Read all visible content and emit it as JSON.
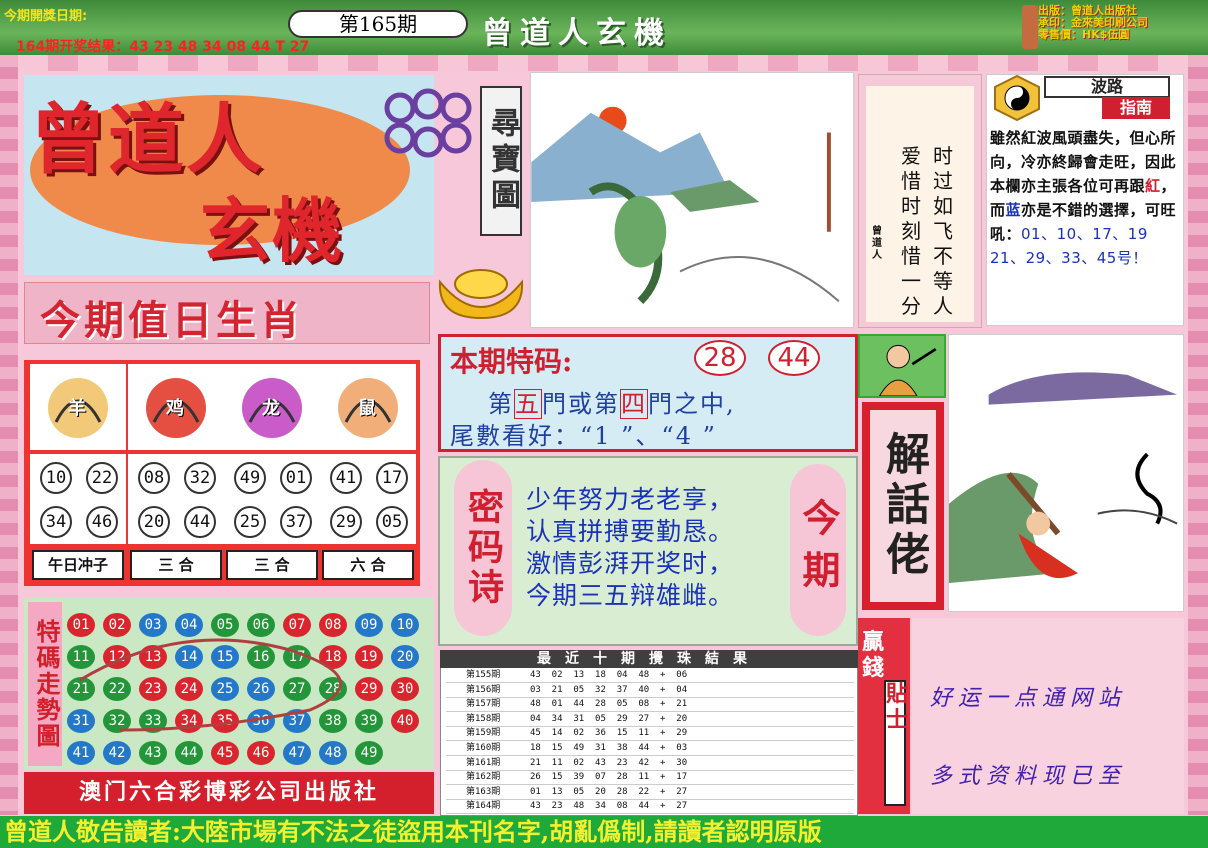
{
  "header": {
    "next_draw_label": "今期開獎日期:",
    "last_result": "164期开奖结果：43 23 48 34 08 44 T 27",
    "issue": "第165期",
    "title": "曾道人玄機",
    "publisher_lines": [
      "出版：曾道人出版社",
      "承印：金來美印刷公司",
      "零售價：HK$伍圓"
    ]
  },
  "logo": {
    "line1": "曾道人",
    "line2": "玄機",
    "side_label": "尋寶圖"
  },
  "poem": {
    "col1": "时过如飞不等人",
    "col2": "爱惜时刻惜一分",
    "signature": "曾道人"
  },
  "guide": {
    "badge_line1": "波路",
    "badge_line2": "指南",
    "text_a": "雖然紅波風頭盡失，但心所向，冷亦終歸會走旺，因此本欄亦主張各位可再跟",
    "word_red": "紅",
    "text_b": "，而",
    "word_blue": "蓝",
    "text_c": "亦是不錯的選擇，可旺吼：",
    "numbers": "01、10、17、19  21、29、33、45号！"
  },
  "zodiac": {
    "heading": "今期值日生肖",
    "animals": [
      {
        "icon": "goat-icon",
        "char": "羊",
        "nums": [
          "10",
          "22",
          "34",
          "46"
        ],
        "label": "午日冲子"
      },
      {
        "icon": "rooster-icon",
        "char": "鸡",
        "nums": [
          "08",
          "32",
          "20",
          "44"
        ],
        "label": "三 合"
      },
      {
        "icon": "dragon-icon",
        "char": "龙",
        "nums": [
          "49",
          "01",
          "25",
          "37"
        ],
        "label": "三 合"
      },
      {
        "icon": "rat-icon",
        "char": "鼠",
        "nums": [
          "41",
          "17",
          "29",
          "05"
        ],
        "label": "六 合"
      }
    ]
  },
  "trend": {
    "heading": "特碼走勢圖",
    "balls": [
      [
        "01",
        "02",
        "03",
        "04",
        "05",
        "06",
        "07",
        "08",
        "09",
        "10"
      ],
      [
        "11",
        "12",
        "13",
        "14",
        "15",
        "16",
        "17",
        "18",
        "19",
        "20"
      ],
      [
        "21",
        "22",
        "23",
        "24",
        "25",
        "26",
        "27",
        "28",
        "29",
        "30"
      ],
      [
        "31",
        "32",
        "33",
        "34",
        "35",
        "36",
        "37",
        "38",
        "39",
        "40"
      ],
      [
        "41",
        "42",
        "43",
        "44",
        "45",
        "46",
        "47",
        "48",
        "49"
      ]
    ],
    "colors": {
      "red": "#d9262e",
      "blue": "#2478c8",
      "green": "#23963a"
    },
    "footer": "澳门六合彩博彩公司出版社"
  },
  "special": {
    "title": "本期特码:",
    "numbers": [
      "28",
      "44"
    ],
    "line1_a": "第",
    "line1_b": "五",
    "line1_c": "門或第",
    "line1_d": "四",
    "line1_e": "門之中,",
    "line2": "尾數看好：“1 ”、“4 ”"
  },
  "secret_poem": {
    "left_label": "密码诗",
    "right_label": "今期",
    "lines": [
      "少年努力老老享，",
      "认真拼搏要勤恳。",
      "激情彭湃开奖时，",
      "今期三五辩雄雌。"
    ]
  },
  "results": {
    "title": "最近十期攪珠結果",
    "rows": [
      {
        "period": "第155期",
        "nums": "43  02  13  18  04  48  +  06"
      },
      {
        "period": "第156期",
        "nums": "03  21  05  32  37  40  +  04"
      },
      {
        "period": "第157期",
        "nums": "48  01  44  28  05  08  +  21"
      },
      {
        "period": "第158期",
        "nums": "04  34  31  05  29  27  +  20"
      },
      {
        "period": "第159期",
        "nums": "45  14  02  36  15  11  +  29"
      },
      {
        "period": "第160期",
        "nums": "18  15  49  31  38  44  +  03"
      },
      {
        "period": "第161期",
        "nums": "21  11  02  43  23  42  +  30"
      },
      {
        "period": "第162期",
        "nums": "26  15  39  07  28  11  +  17"
      },
      {
        "period": "第163期",
        "nums": "01  13  05  20  28  22  +  27"
      },
      {
        "period": "第164期",
        "nums": "43  23  48  34  08  44  +  27"
      }
    ]
  },
  "right": {
    "jie_label": "解話佬",
    "yq_label1": "贏錢",
    "yq_label2": "貼士",
    "hand1": "好运一点通网站",
    "hand2": "多式资料现已至"
  },
  "footer": {
    "notice": "曾道人敬告讀者:大陸市場有不法之徒盜用本刊名字,胡亂僞制,請讀者認明原版"
  }
}
